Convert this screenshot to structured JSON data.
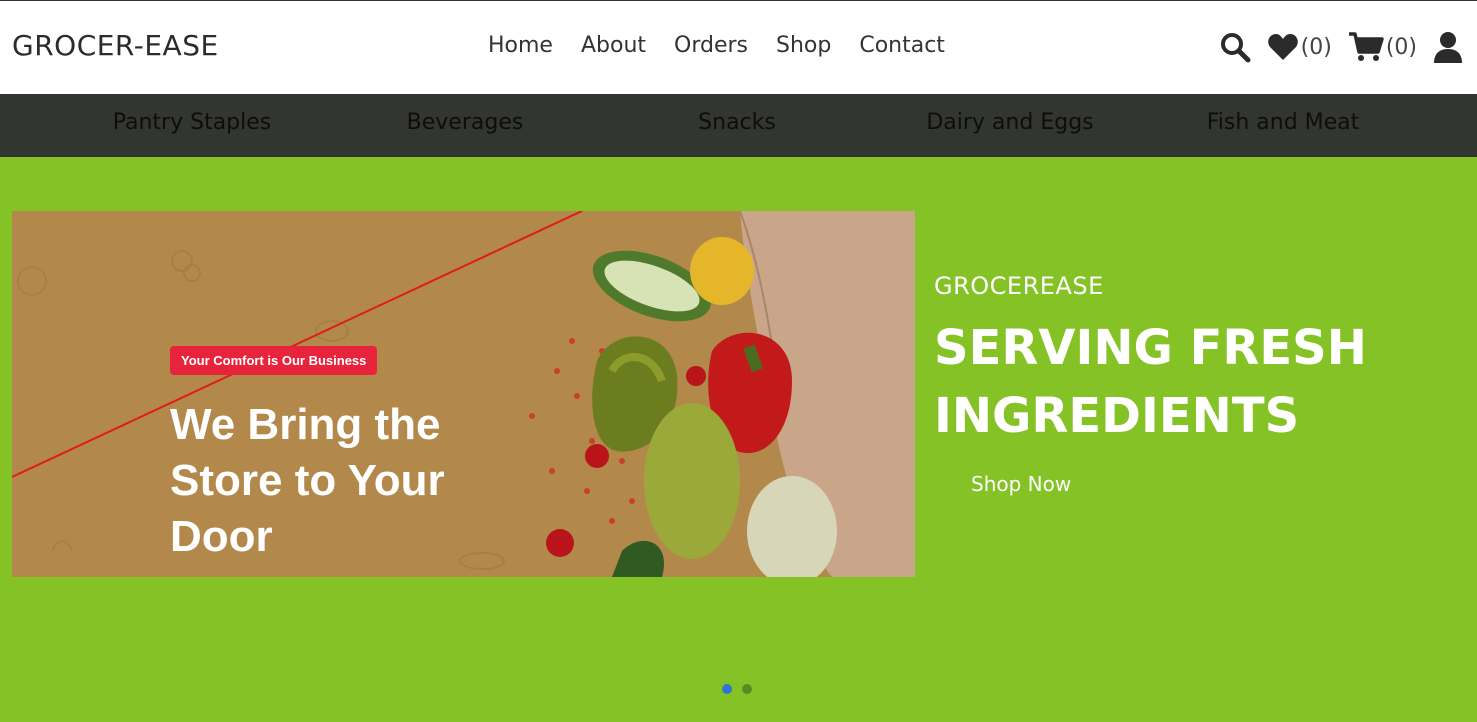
{
  "header": {
    "brand": "GROCER-EASE",
    "nav": [
      "Home",
      "About",
      "Orders",
      "Shop",
      "Contact"
    ],
    "icons": {
      "search": "search-icon",
      "wishlist": "heart-icon",
      "wishlist_count": "(0)",
      "cart": "cart-icon",
      "cart_count": "(0)",
      "account": "user-icon"
    }
  },
  "categories": [
    "Pantry Staples",
    "Beverages",
    "Snacks",
    "Dairy and Eggs",
    "Fish and Meat"
  ],
  "hero": {
    "banner": {
      "badge": "Your Comfort is Our Business",
      "heading": "We Bring the Store to Your Door"
    },
    "eyebrow": "GROCEREASE",
    "headline": "SERVING FRESH INGREDIENTS",
    "cta": "Shop Now",
    "slides_total": 2,
    "active_slide": 1
  },
  "colors": {
    "accent_green": "#84c225",
    "category_bar": "#333530",
    "badge_red": "#e8243d",
    "active_dot": "#2f74d0"
  }
}
